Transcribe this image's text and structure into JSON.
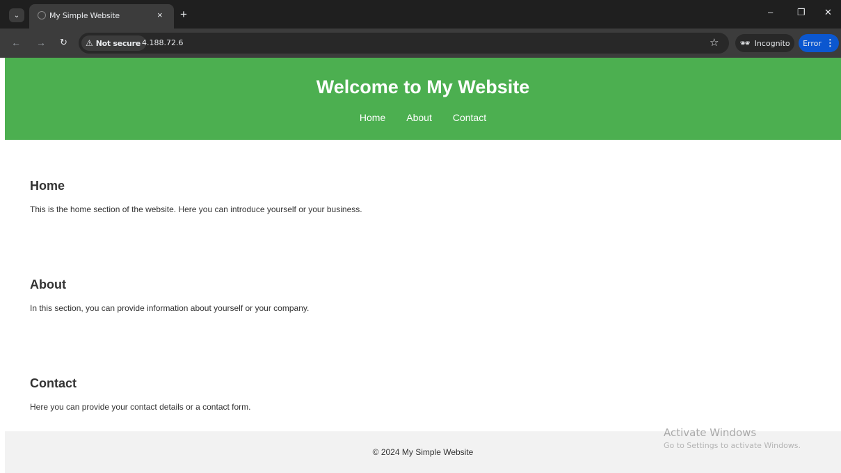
{
  "browser": {
    "tab_title": "My Simple Website",
    "tab_close": "×",
    "new_tab": "+",
    "security_label": "Not secure",
    "url": "4.188.72.6",
    "incognito_label": "Incognito",
    "error_label": "Error",
    "window_controls": {
      "minimize": "–",
      "restore": "❐",
      "close": "✕"
    },
    "icons": [
      "tab-menu-icon",
      "favicon-icon",
      "back-icon",
      "forward-icon",
      "reload-icon",
      "warning-icon",
      "bookmark-star-icon",
      "incognito-icon",
      "more-icon"
    ]
  },
  "site": {
    "title": "Welcome to My Website",
    "nav": [
      "Home",
      "About",
      "Contact"
    ],
    "sections": [
      {
        "heading": "Home",
        "text": "This is the home section of the website. Here you can introduce yourself or your business."
      },
      {
        "heading": "About",
        "text": "In this section, you can provide information about yourself or your company."
      },
      {
        "heading": "Contact",
        "text": "Here you can provide your contact details or a contact form."
      }
    ],
    "footer": "© 2024 My Simple Website",
    "colors": {
      "header_bg": "#4caf50",
      "footer_bg": "#f2f2f2",
      "text": "#333333"
    }
  },
  "os_overlay": {
    "activate_title": "Activate Windows",
    "activate_sub": "Go to Settings to activate Windows."
  }
}
